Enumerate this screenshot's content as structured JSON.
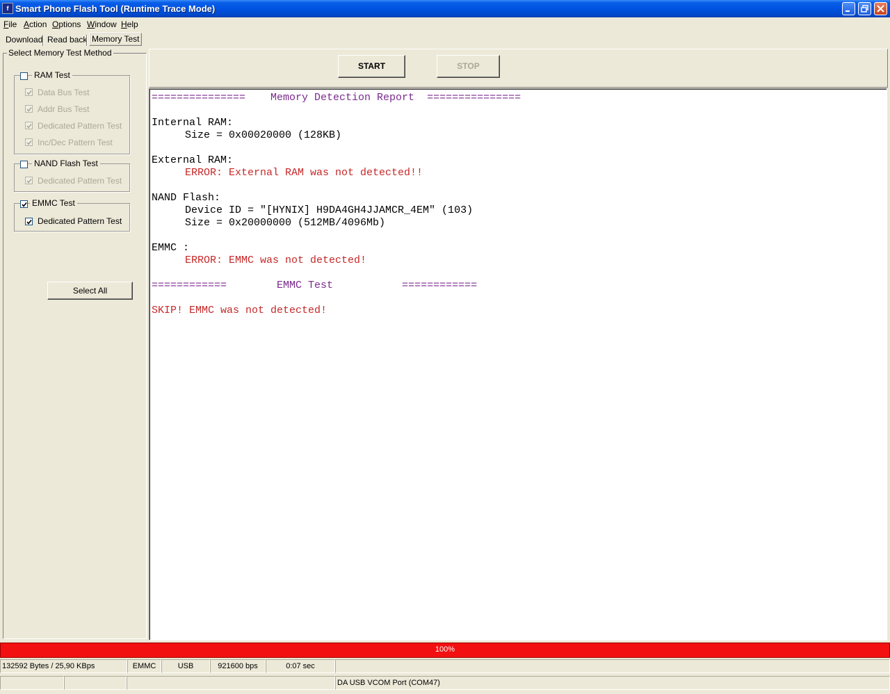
{
  "window": {
    "title": "Smart Phone Flash Tool (Runtime Trace Mode)",
    "icon": "app-icon"
  },
  "menu": {
    "file": {
      "first": "F",
      "rest": "ile"
    },
    "action": {
      "first": "A",
      "rest": "ction"
    },
    "options": {
      "first": "O",
      "rest": "ptions"
    },
    "window": {
      "first": "W",
      "rest": "indow"
    },
    "help": {
      "first": "H",
      "rest": "elp"
    }
  },
  "tabs": [
    "Download",
    "Read back",
    "Memory Test"
  ],
  "active_tab": "Memory Test",
  "left": {
    "title": "Select Memory Test Method",
    "ram_group": {
      "label": "RAM Test",
      "checked": false,
      "items": [
        {
          "label": "Data Bus Test",
          "checked": true,
          "enabled": false
        },
        {
          "label": "Addr Bus Test",
          "checked": true,
          "enabled": false
        },
        {
          "label": "Dedicated Pattern Test",
          "checked": true,
          "enabled": false
        },
        {
          "label": "Inc/Dec Pattern Test",
          "checked": true,
          "enabled": false
        }
      ]
    },
    "nand_group": {
      "label": "NAND Flash Test",
      "checked": false,
      "items": [
        {
          "label": "Dedicated Pattern Test",
          "checked": true,
          "enabled": false
        }
      ]
    },
    "emmc_group": {
      "label": "EMMC Test",
      "checked": true,
      "items": [
        {
          "label": "Dedicated Pattern Test",
          "checked": true,
          "enabled": true
        }
      ]
    },
    "select_all": "Select All"
  },
  "buttons": {
    "start": "START",
    "stop": "STOP"
  },
  "report": {
    "header": "===============    Memory Detection Report  ===============",
    "internal_title": "Internal RAM:",
    "internal_size": "Size = 0x00020000 (128KB)",
    "external_title": "External RAM:",
    "external_error": "ERROR: External RAM was not detected!!",
    "nand_title": "NAND Flash:",
    "nand_device": "Device ID = \"[HYNIX] H9DA4GH4JJAMCR_4EM\" (103)",
    "nand_size": "Size = 0x20000000 (512MB/4096Mb)",
    "emmc_title": "EMMC :",
    "emmc_error": "ERROR: EMMC was not detected!",
    "emmc_test_header": "============        EMMC Test           ============",
    "skip": "SKIP! EMMC was not detected!"
  },
  "progress": {
    "percent": 100,
    "label": "100%",
    "color": "#f21010"
  },
  "status": {
    "bytes": "132592 Bytes / 25,90 KBps",
    "storage": "EMMC",
    "conn": "USB",
    "baud": "921600 bps",
    "time": "0:07 sec",
    "port": "DA USB VCOM Port (COM47)"
  },
  "colors": {
    "error": "#c62828",
    "section": "#7a2a8c"
  }
}
